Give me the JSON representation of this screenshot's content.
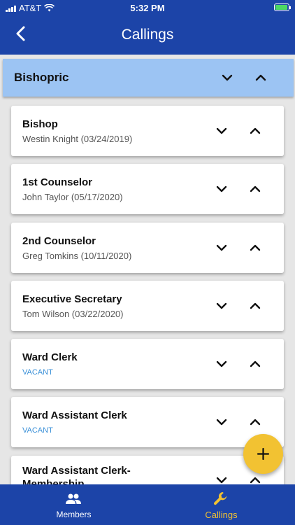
{
  "status_bar": {
    "carrier": "AT&T",
    "time": "5:32 PM"
  },
  "header": {
    "title": "Callings"
  },
  "group": {
    "name": "Bishopric"
  },
  "callings": [
    {
      "name": "Bishop",
      "holder": "Westin Knight (03/24/2019)"
    },
    {
      "name": "1st Counselor",
      "holder": "John Taylor (05/17/2020)"
    },
    {
      "name": "2nd Counselor",
      "holder": "Greg Tomkins (10/11/2020)"
    },
    {
      "name": "Executive Secretary",
      "holder": "Tom Wilson (03/22/2020)"
    },
    {
      "name": "Ward Clerk",
      "holder": "VACANT"
    },
    {
      "name": "Ward Assistant Clerk",
      "holder": "VACANT"
    },
    {
      "name": "Ward Assistant Clerk-Membership",
      "holder": ""
    }
  ],
  "tabs": [
    {
      "label": "Members",
      "icon": "people-icon",
      "active": false
    },
    {
      "label": "Callings",
      "icon": "wrench-icon",
      "active": true
    }
  ],
  "colors": {
    "primary": "#1c44a8",
    "accent": "#f2c232",
    "group_header": "#9cc4f3",
    "vacant": "#3c91d8"
  }
}
